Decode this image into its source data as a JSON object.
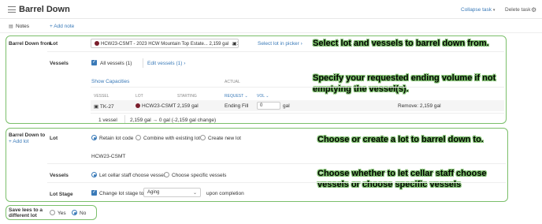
{
  "header": {
    "title": "Barrel Down",
    "collapse_label": "Collapse task",
    "delete_label": "Delete task"
  },
  "notes": {
    "label": "Notes",
    "add_note": "+ Add note"
  },
  "from": {
    "section_label": "Barrel Down from",
    "lot_label": "Lot",
    "lot_value": "HCW23-CSMT - 2023 HCW Mountain Top Estate... 2,159 gal",
    "lot_vessel_count": "1",
    "select_picker": "Select lot in picker",
    "vessels_label": "Vessels",
    "all_vessels": "All vessels (1)",
    "edit_vessels": "Edit vessels (1)",
    "show_capacities": "Show Capacities",
    "actual_header": "ACTUAL",
    "columns": [
      "VESSEL",
      "LOT",
      "STARTING",
      "REQUEST",
      "VOL"
    ],
    "row": {
      "vessel": "TK-27",
      "lot": "HCW23-CSMT",
      "starting": "2,159 gal",
      "request": "Ending Fill",
      "vol_value": "0",
      "vol_unit": "gal",
      "remove": "Remove: 2,159 gal"
    },
    "summary_vessels": "1 vessel",
    "summary_change": "2,159 gal → 0 gal (-2,159 gal change)"
  },
  "to": {
    "section_label": "Barrel Down to",
    "add_lot": "+ Add lot",
    "lot_label": "Lot",
    "options": [
      "Retain lot code",
      "Combine with existing lot",
      "Create new lot"
    ],
    "lot_code": "HCW23-CSMT",
    "vessels_label": "Vessels",
    "vessel_options": [
      "Let cellar staff choose vessels",
      "Choose specific vessels"
    ],
    "stage_label": "Lot Stage",
    "change_stage": "Change lot stage to",
    "stage_value": "Aging",
    "upon_completion": "upon completion"
  },
  "lees": {
    "label_line1": "Save lees to a",
    "label_line2": "different lot",
    "yes": "Yes",
    "no": "No"
  },
  "annotations": {
    "a1": "Select lot and vessels to barrel down from.",
    "a2_line1": "Specify your requested ending volume if not",
    "a2_line2": "emptying the vessel(s).",
    "a3": "Choose or create a lot  to barrel down to.",
    "a4_line1": "Choose whether to let cellar staff choose",
    "a4_line2": "vessels or choose specific vessels"
  },
  "colors": {
    "accent": "#3a7ab8",
    "annotation_border": "#7bbf6a",
    "lot_dot": "#7a1e2c"
  }
}
